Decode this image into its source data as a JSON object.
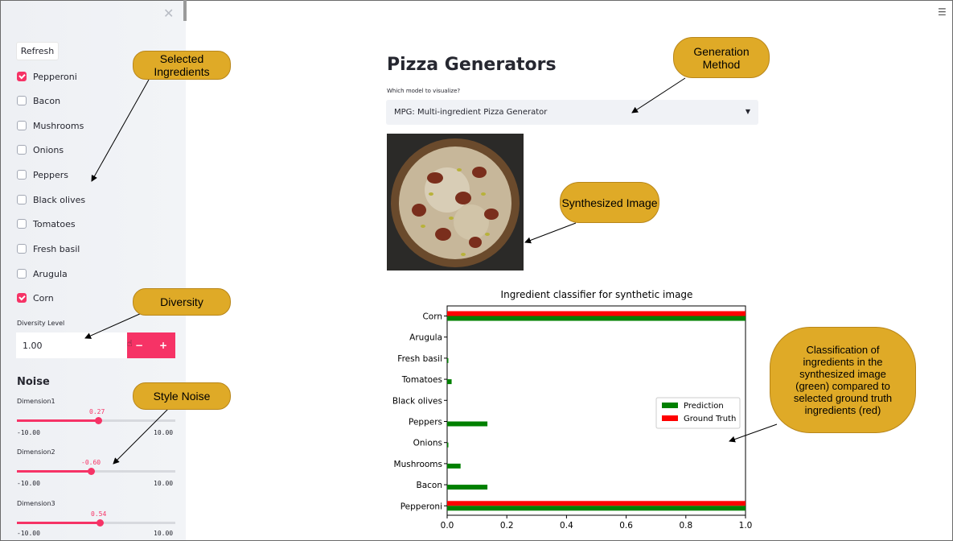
{
  "sidebar": {
    "close_icon": "close-icon",
    "refresh_label": "Refresh",
    "ingredients": [
      {
        "label": "Pepperoni",
        "checked": true
      },
      {
        "label": "Bacon",
        "checked": false
      },
      {
        "label": "Mushrooms",
        "checked": false
      },
      {
        "label": "Onions",
        "checked": false
      },
      {
        "label": "Peppers",
        "checked": false
      },
      {
        "label": "Black olives",
        "checked": false
      },
      {
        "label": "Tomatoes",
        "checked": false
      },
      {
        "label": "Fresh basil",
        "checked": false
      },
      {
        "label": "Arugula",
        "checked": false
      },
      {
        "label": "Corn",
        "checked": true
      }
    ],
    "diversity": {
      "label": "Diversity Level",
      "value": "1.00",
      "minus": "−",
      "plus": "+"
    },
    "noise": {
      "title": "Noise",
      "sliders": [
        {
          "label": "Dimension1",
          "value": "0.27",
          "min": "-10.00",
          "max": "10.00",
          "fraction": 0.5135
        },
        {
          "label": "Dimension2",
          "value": "-0.60",
          "min": "-10.00",
          "max": "10.00",
          "fraction": 0.47
        },
        {
          "label": "Dimension3",
          "value": "0.54",
          "min": "-10.00",
          "max": "10.00",
          "fraction": 0.527
        }
      ]
    }
  },
  "main": {
    "menu_icon": "hamburger-icon",
    "title": "Pizza Generators",
    "select_label": "Which model to visualize?",
    "select_value": "MPG: Multi-ingredient Pizza Generator"
  },
  "callouts": {
    "selected_ingredients": "Selected Ingredients",
    "generation_method": "Generation Method",
    "synthesized_image": "Synthesized Image",
    "diversity": "Diversity",
    "style_noise": "Style Noise",
    "classification": "Classification of ingredients in the synthesized image (green) compared to selected ground truth ingredients (red)"
  },
  "colors": {
    "accent": "#f63366",
    "prediction": "#008000",
    "ground_truth": "#ff0000",
    "callout": "#dfaa27"
  },
  "chart_data": {
    "type": "bar",
    "orientation": "horizontal",
    "title": "Ingredient classifier for synthetic image",
    "categories": [
      "Corn",
      "Arugula",
      "Fresh basil",
      "Tomatoes",
      "Black olives",
      "Peppers",
      "Onions",
      "Mushrooms",
      "Bacon",
      "Pepperoni"
    ],
    "series": [
      {
        "name": "Prediction",
        "color": "#008000",
        "values": [
          1.0,
          0.0,
          0.004,
          0.015,
          0.0,
          0.135,
          0.004,
          0.045,
          0.135,
          1.0
        ]
      },
      {
        "name": "Ground Truth",
        "color": "#ff0000",
        "values": [
          1,
          0,
          0,
          0,
          0,
          0,
          0,
          0,
          0,
          1
        ]
      }
    ],
    "xlim": [
      0.0,
      1.0
    ],
    "xticks": [
      "0.0",
      "0.2",
      "0.4",
      "0.6",
      "0.8",
      "1.0"
    ],
    "legend_position": "center-right",
    "grid": false
  }
}
